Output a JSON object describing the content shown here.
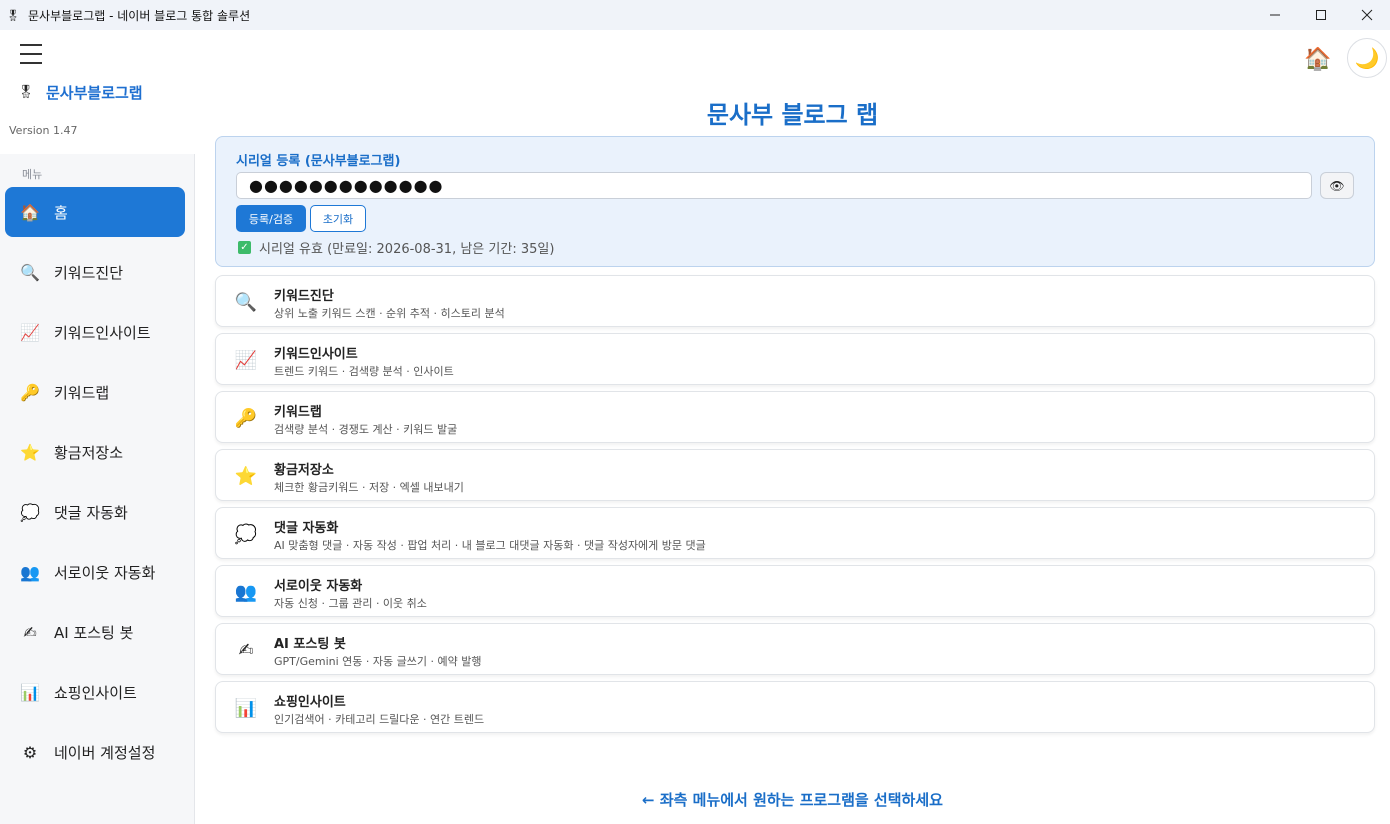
{
  "window": {
    "title": "문사부블로그랩 - 네이버 블로그 통합 솔루션",
    "app_icon": "app-logo-icon"
  },
  "sidebar": {
    "brand_name": "문사부블로그랩",
    "version": "Version 1.47",
    "menu_label": "메뉴",
    "items": [
      {
        "label": "홈",
        "icon": "house-icon",
        "glyph": "🏠",
        "active": true
      },
      {
        "label": "키워드진단",
        "icon": "magnifier-icon",
        "glyph": "🔍",
        "active": false
      },
      {
        "label": "키워드인사이트",
        "icon": "chart-up-icon",
        "glyph": "📈",
        "active": false
      },
      {
        "label": "키워드랩",
        "icon": "key-icon",
        "glyph": "🔑",
        "active": false
      },
      {
        "label": "황금저장소",
        "icon": "star-icon",
        "glyph": "⭐",
        "active": false
      },
      {
        "label": "댓글 자동화",
        "icon": "speech-bubble-icon",
        "glyph": "💭",
        "active": false
      },
      {
        "label": "서로이웃 자동화",
        "icon": "people-icon",
        "glyph": "👥",
        "active": false
      },
      {
        "label": "AI 포스팅 봇",
        "icon": "writing-hand-icon",
        "glyph": "✍",
        "active": false
      },
      {
        "label": "쇼핑인사이트",
        "icon": "bar-chart-icon",
        "glyph": "📊",
        "active": false
      },
      {
        "label": "네이버 계정설정",
        "icon": "gear-icon",
        "glyph": "⚙",
        "active": false
      }
    ]
  },
  "header": {
    "home_icon": "🏠",
    "theme_icon": "🌙"
  },
  "main": {
    "page_title": "문사부 블로그 랩",
    "serial": {
      "title": "시리얼 등록 (문사부블로그랩)",
      "value": "●●●●●●●●●●●●●",
      "register_label": "등록/검증",
      "reset_label": "초기화",
      "status_text": "시리얼 유효 (만료일: 2026-08-31, 남은 기간: 35일)"
    },
    "cards": [
      {
        "title": "키워드진단",
        "desc": "상위 노출 키워드 스캔 · 순위 추적 · 히스토리 분석",
        "icon": "magnifier-icon",
        "glyph": "🔍"
      },
      {
        "title": "키워드인사이트",
        "desc": "트렌드 키워드 · 검색량 분석 · 인사이트",
        "icon": "chart-up-icon",
        "glyph": "📈"
      },
      {
        "title": "키워드랩",
        "desc": "검색량 분석 · 경쟁도 계산 · 키워드 발굴",
        "icon": "key-icon",
        "glyph": "🔑"
      },
      {
        "title": "황금저장소",
        "desc": "체크한 황금키워드 · 저장 · 엑셀 내보내기",
        "icon": "star-icon",
        "glyph": "⭐"
      },
      {
        "title": "댓글 자동화",
        "desc": "AI 맞춤형 댓글 · 자동 작성 · 팝업 처리 · 내 블로그 대댓글 자동화 · 댓글 작성자에게 방문 댓글",
        "icon": "speech-bubble-icon",
        "glyph": "💭"
      },
      {
        "title": "서로이웃 자동화",
        "desc": "자동 신청 · 그룹 관리 · 이웃 취소",
        "icon": "people-icon",
        "glyph": "👥"
      },
      {
        "title": "AI 포스팅 봇",
        "desc": "GPT/Gemini 연동 · 자동 글쓰기 · 예약 발행",
        "icon": "writing-hand-icon",
        "glyph": "✍"
      },
      {
        "title": "쇼핑인사이트",
        "desc": "인기검색어 · 카테고리 드릴다운 · 연간 트렌드",
        "icon": "bar-chart-icon",
        "glyph": "📊"
      }
    ],
    "footer_hint": "← 좌측 메뉴에서 원하는 프로그램을 선택하세요"
  },
  "colors": {
    "accent": "#1e78d6",
    "title_blue": "#1a6ec8",
    "serial_bg": "#eaf2fc",
    "success": "#3dbb6a"
  }
}
